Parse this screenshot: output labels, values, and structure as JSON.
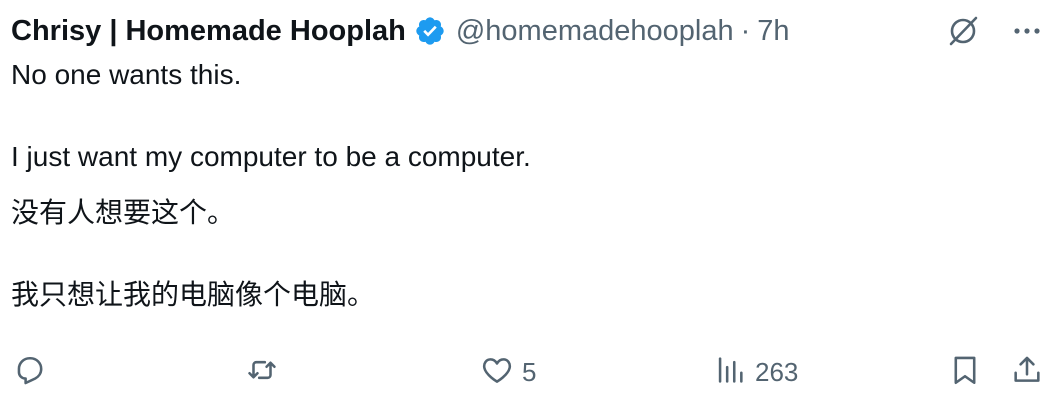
{
  "post": {
    "author_name": "Chrisy | Homemade Hooplah",
    "handle": "@homemadehooplah",
    "separator": "·",
    "time": "7h",
    "body": {
      "line1": "No one wants this.",
      "line2": "I just want my computer to be a computer.",
      "line3": "没有人想要这个。",
      "line4": "我只想让我的电脑像个电脑。"
    }
  },
  "actions": {
    "likes": "5",
    "views": "263"
  },
  "icons": {
    "verified": "verified-badge-icon",
    "grok": "grok-icon",
    "more": "more-icon",
    "reply": "reply-icon",
    "repost": "repost-icon",
    "like": "heart-icon",
    "views": "views-chart-icon",
    "bookmark": "bookmark-icon",
    "share": "share-icon"
  },
  "colors": {
    "text": "#0f1419",
    "secondary": "#536471",
    "verified": "#1d9bf0"
  }
}
